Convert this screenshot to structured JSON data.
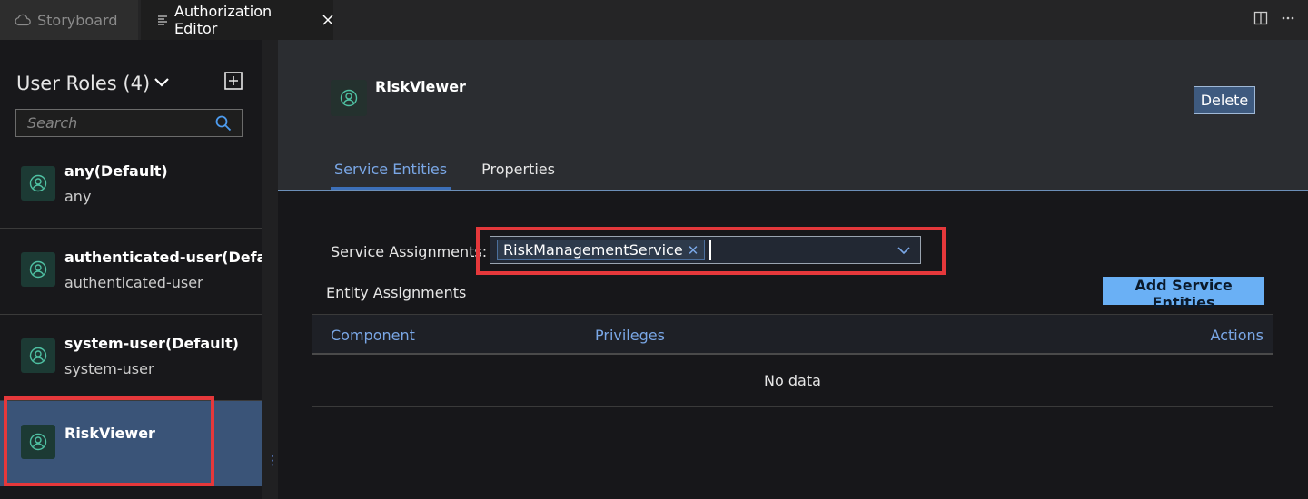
{
  "tabs": [
    {
      "label": "Storyboard",
      "icon": "cloud-icon",
      "active": false
    },
    {
      "label": "Authorization Editor",
      "icon": "list-icon",
      "active": true
    }
  ],
  "sidebar": {
    "title": "User Roles (4)",
    "search_placeholder": "Search",
    "roles": [
      {
        "name": "any(Default)",
        "sub": "any",
        "selected": false
      },
      {
        "name": "authenticated-user(Default)",
        "sub": "authenticated-user",
        "selected": false
      },
      {
        "name": "system-user(Default)",
        "sub": "system-user",
        "selected": false
      },
      {
        "name": "RiskViewer",
        "sub": "",
        "selected": true
      }
    ]
  },
  "main": {
    "title": "RiskViewer",
    "delete_label": "Delete",
    "tabs": [
      {
        "label": "Service Entities",
        "active": true
      },
      {
        "label": "Properties",
        "active": false
      }
    ],
    "service_assignments_label": "Service Assignments:",
    "service_tokens": [
      "RiskManagementService"
    ],
    "entity_assignments_label": "Entity Assignments",
    "add_button_label": "Add Service Entities",
    "table": {
      "columns": [
        "Component",
        "Privileges",
        "Actions"
      ],
      "empty_text": "No data"
    }
  },
  "colors": {
    "accent": "#7aa7e6",
    "selected_bg": "#3a5478",
    "highlight": "#e5383b",
    "primary_button": "#6ab0f5"
  }
}
